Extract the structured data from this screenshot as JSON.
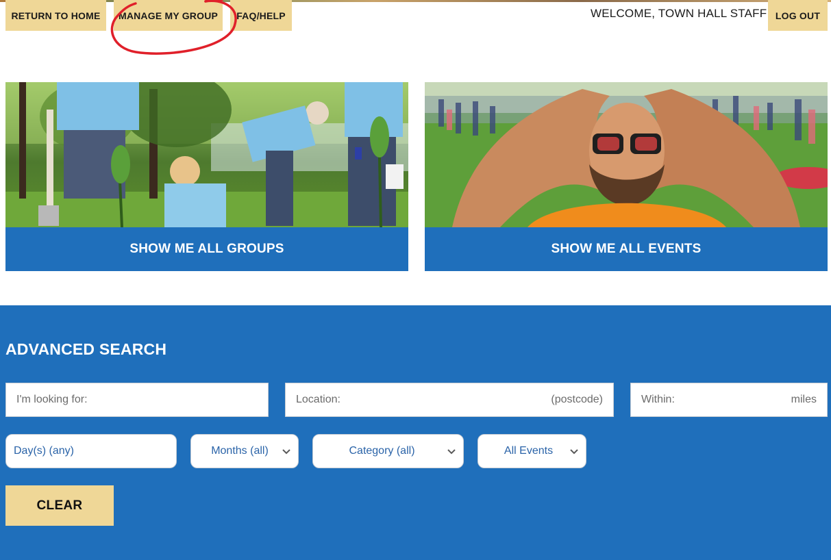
{
  "nav": {
    "return_home": "RETURN TO HOME",
    "manage_group": "MANAGE MY GROUP",
    "faq_help": "FAQ/HELP",
    "welcome": "WELCOME, TOWN HALL STAFF",
    "log_out": "LOG OUT"
  },
  "cards": {
    "groups_cta": "SHOW ME ALL GROUPS",
    "events_cta": "SHOW ME ALL EVENTS"
  },
  "search": {
    "title": "ADVANCED SEARCH",
    "looking_for_placeholder": "I'm looking for:",
    "location_placeholder": "Location:",
    "location_suffix": "(postcode)",
    "within_placeholder": "Within:",
    "within_suffix": "miles",
    "days_value": "Day(s) (any)",
    "months_value": "Months (all)",
    "category_value": "Category (all)",
    "events_value": "All Events",
    "clear_label": "CLEAR"
  },
  "colors": {
    "nav_button_bg": "#efd797",
    "primary_blue": "#1f6fbb",
    "annotation_red": "#e0202a"
  },
  "icons": [
    "chevron-down-icon"
  ]
}
